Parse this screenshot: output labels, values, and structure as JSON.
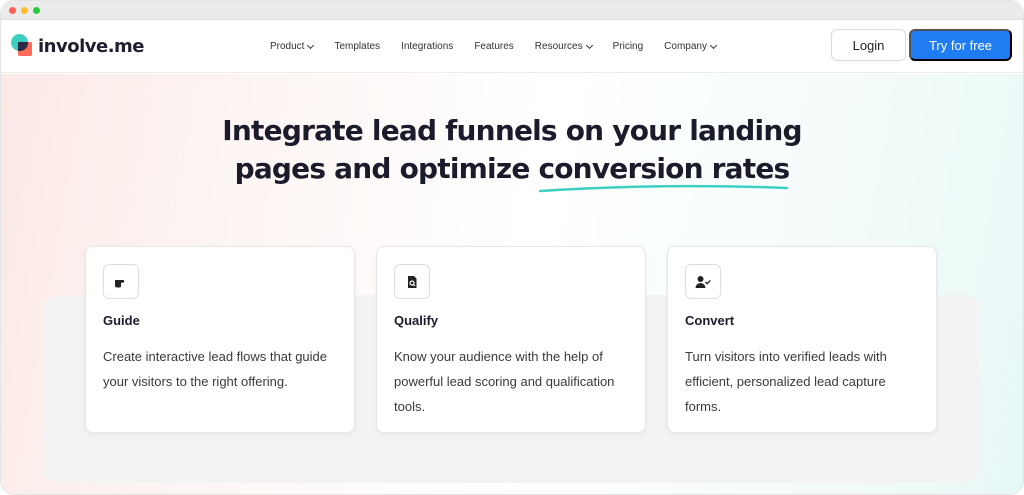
{
  "brand": {
    "name": "involve.me"
  },
  "nav": {
    "items": [
      {
        "label": "Product",
        "has_dropdown": true
      },
      {
        "label": "Templates",
        "has_dropdown": false
      },
      {
        "label": "Integrations",
        "has_dropdown": false
      },
      {
        "label": "Features",
        "has_dropdown": false
      },
      {
        "label": "Resources",
        "has_dropdown": true
      },
      {
        "label": "Pricing",
        "has_dropdown": false
      },
      {
        "label": "Company",
        "has_dropdown": true
      }
    ],
    "login_label": "Login",
    "cta_label": "Try for free"
  },
  "hero": {
    "headline_line1": "Integrate lead funnels on your landing",
    "headline_line2_prefix": "pages and optimize ",
    "headline_line2_accent": "conversion rates"
  },
  "cards": [
    {
      "title": "Guide",
      "icon": "pointing-hand-icon",
      "description": "Create interactive lead flows that guide your visitors to the right offering."
    },
    {
      "title": "Qualify",
      "icon": "document-search-icon",
      "description": "Know your audience with the help of powerful lead scoring and qualification tools."
    },
    {
      "title": "Convert",
      "icon": "user-check-icon",
      "description": "Turn visitors into verified leads with efficient, personalized lead capture forms."
    }
  ],
  "colors": {
    "primary": "#1f7cf2",
    "accent_underline": "#3ecfc1",
    "logo_coral": "#ff6a5a",
    "text_dark": "#1b1b2b"
  }
}
